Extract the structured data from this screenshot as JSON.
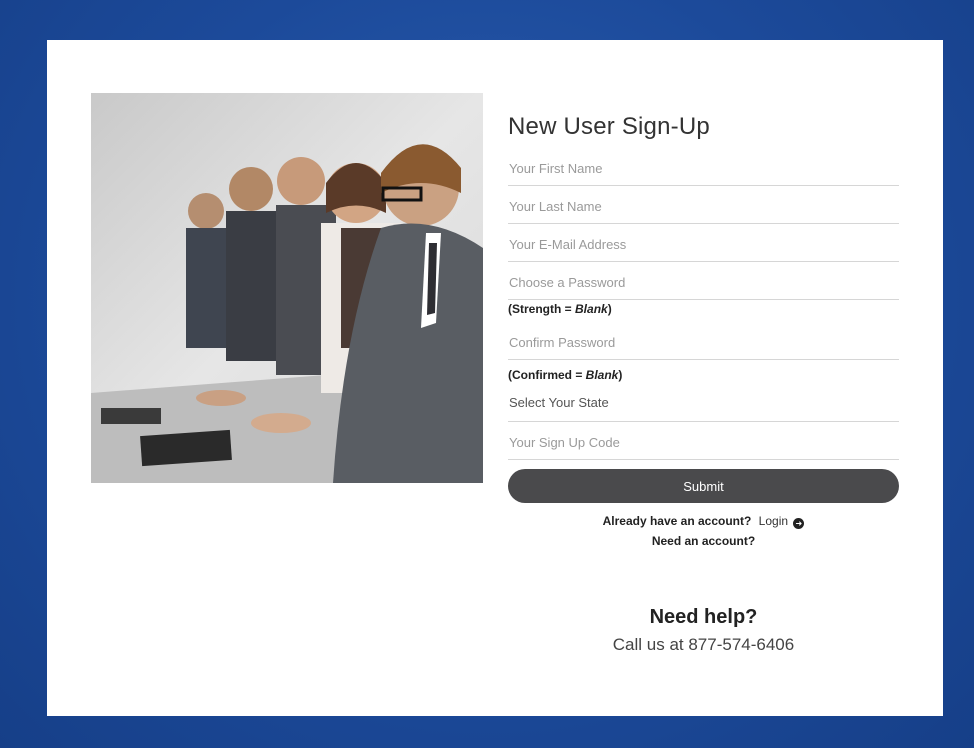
{
  "signup": {
    "title": "New User Sign-Up",
    "fields": {
      "first_name_placeholder": "Your First Name",
      "last_name_placeholder": "Your Last Name",
      "email_placeholder": "Your E-Mail Address",
      "password_placeholder": "Choose a Password",
      "confirm_placeholder": "Confirm Password",
      "state_label": "Select Your State",
      "code_placeholder": "Your Sign Up Code"
    },
    "strength_prefix": "(Strength = ",
    "strength_value": "Blank",
    "strength_suffix": ")",
    "confirmed_prefix": "(Confirmed = ",
    "confirmed_value": "Blank",
    "confirmed_suffix": ")",
    "submit_label": "Submit",
    "already_text": "Already have an account?",
    "login_label": "Login",
    "need_account_text": "Need an account?"
  },
  "help": {
    "title": "Need help?",
    "phone_text": "Call us at 877-574-6406"
  },
  "image": {
    "description_icon": "call-center-photo"
  },
  "colors": {
    "background": "#1c4a9a",
    "button": "#4a4a4c",
    "card": "#ffffff"
  }
}
